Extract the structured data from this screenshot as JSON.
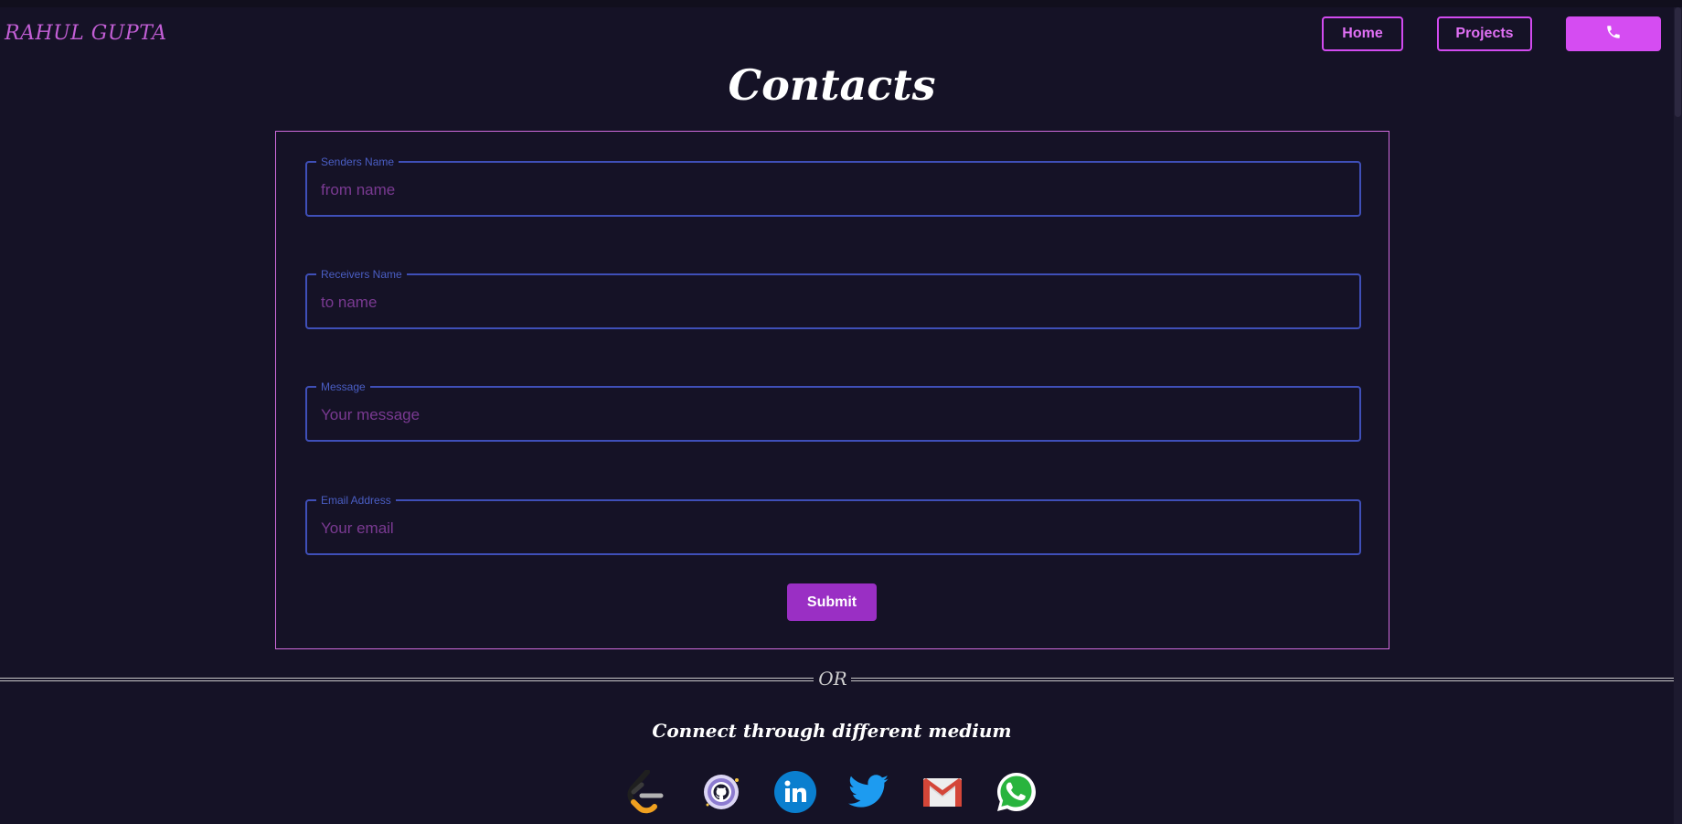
{
  "brand": "RAHUL GUPTA",
  "nav": {
    "home": "Home",
    "projects": "Projects",
    "phone_icon": "phone-icon"
  },
  "page": {
    "title": "Contacts"
  },
  "form": {
    "fields": [
      {
        "label": "Senders Name",
        "placeholder": "from name"
      },
      {
        "label": "Receivers Name",
        "placeholder": "to name"
      },
      {
        "label": "Message",
        "placeholder": "Your message"
      },
      {
        "label": "Email Address",
        "placeholder": "Your email"
      }
    ],
    "submit": "Submit"
  },
  "divider": {
    "text": "OR"
  },
  "connect": {
    "heading": "Connect through different medium",
    "icons": [
      "leetcode-icon",
      "github-icon",
      "linkedin-icon",
      "twitter-icon",
      "gmail-icon",
      "whatsapp-icon"
    ]
  },
  "colors": {
    "background": "#151226",
    "accent": "#d54cf2",
    "field_border": "#3f4fb8",
    "submit": "#9a2fc4"
  }
}
